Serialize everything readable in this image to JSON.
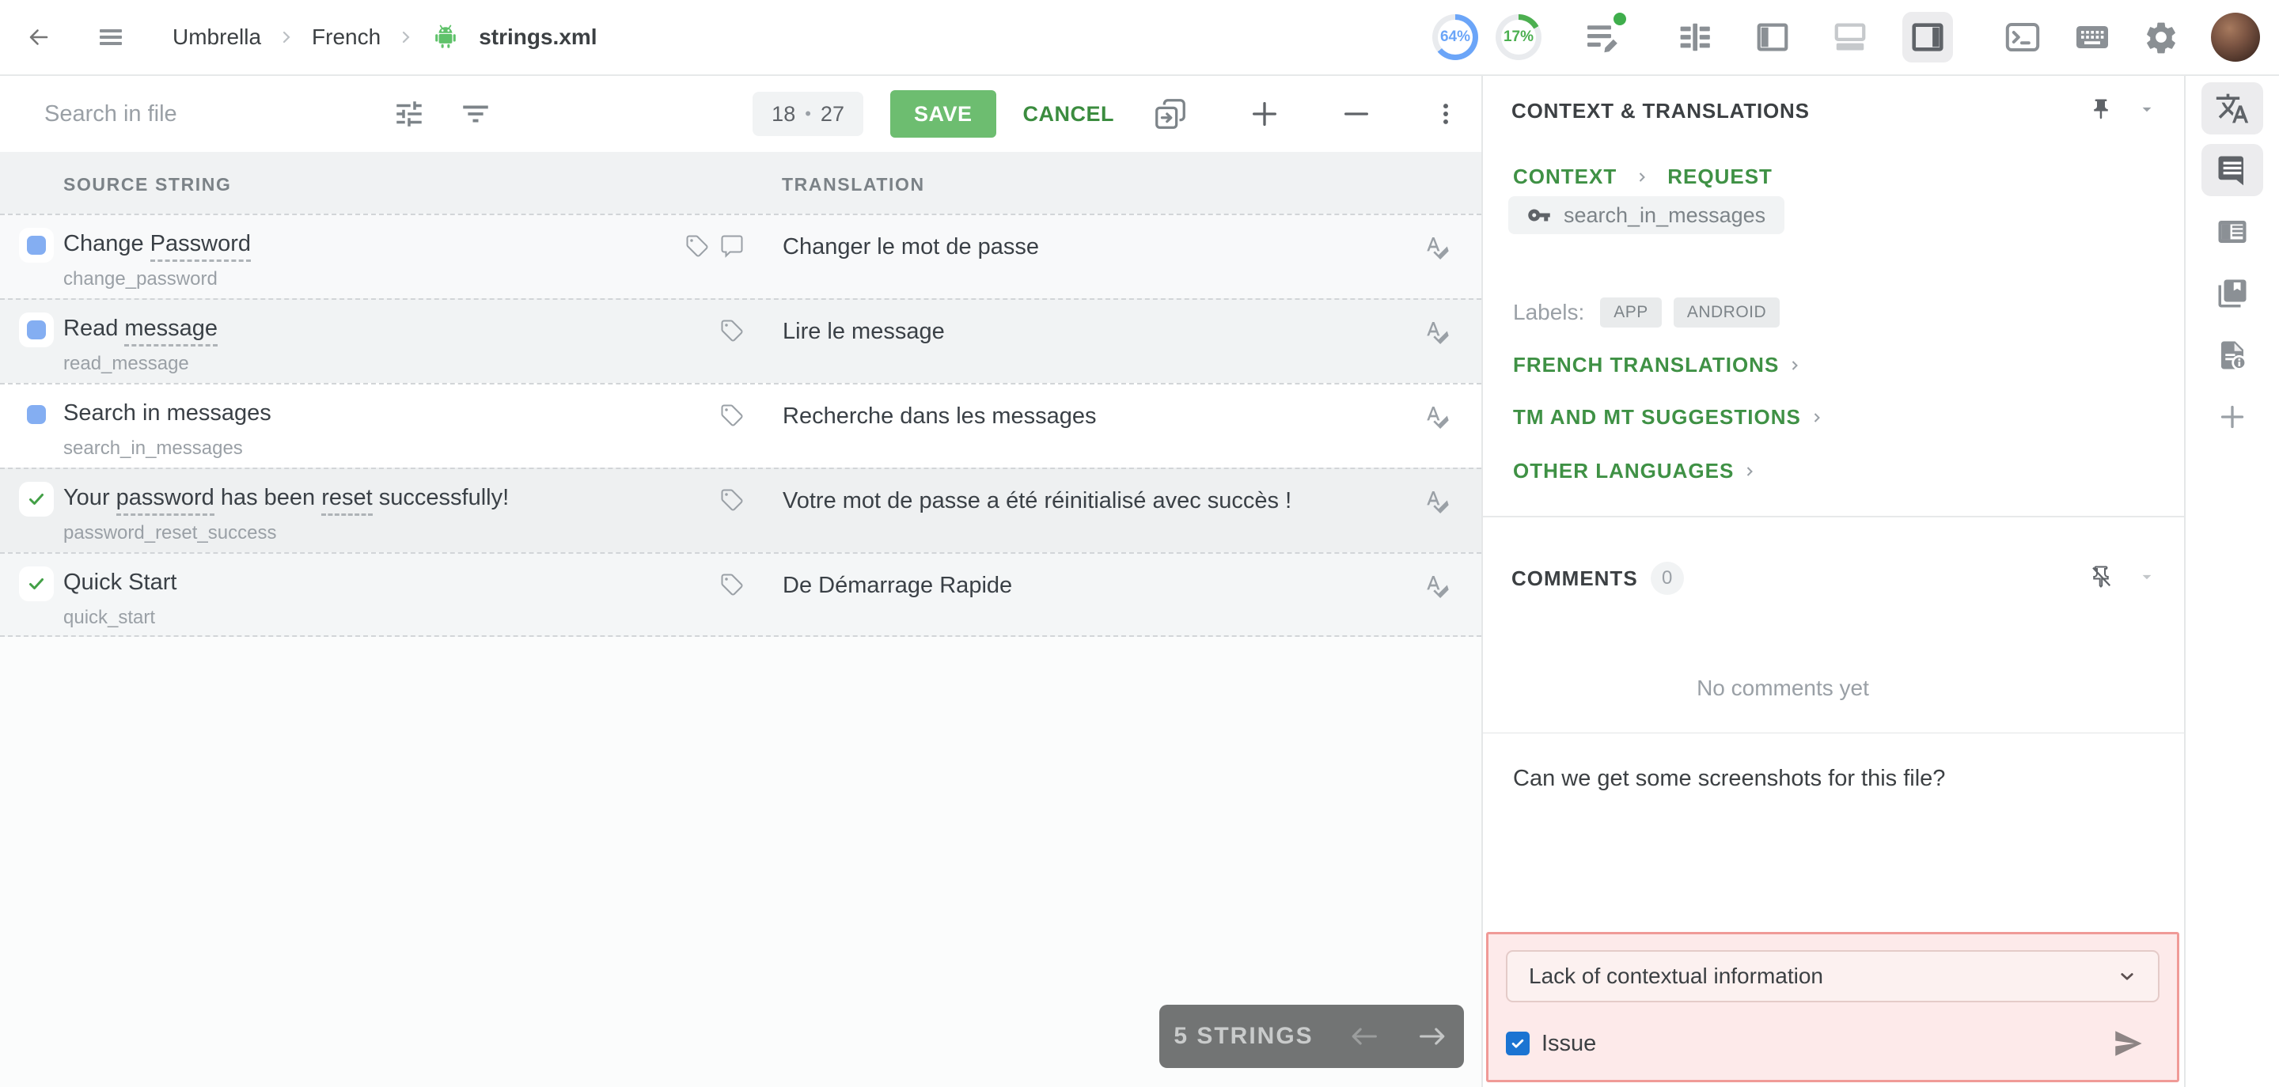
{
  "topbar": {
    "breadcrumb": {
      "project": "Umbrella",
      "language": "French",
      "file": "strings.xml"
    },
    "progress": [
      {
        "value": "64%",
        "pct": 64,
        "color": "#6ba5f8"
      },
      {
        "value": "17%",
        "pct": 17,
        "color": "#4caf50"
      }
    ]
  },
  "toolbar": {
    "search_placeholder": "Search in file",
    "counter": {
      "current": "18",
      "dot": "•",
      "total": "27"
    },
    "save_label": "SAVE",
    "save_color": "#6dbd70",
    "cancel_label": "CANCEL"
  },
  "grid": {
    "columns": [
      "SOURCE STRING",
      "TRANSLATION"
    ],
    "rows": [
      {
        "status": "active",
        "selected": false,
        "has_comment": true,
        "source": [
          {
            "t": "Change ",
            "u": false
          },
          {
            "t": "Password",
            "u": true
          }
        ],
        "key": "change_password",
        "translation": "Changer le mot de passe"
      },
      {
        "status": "active",
        "selected": false,
        "has_comment": false,
        "source": [
          {
            "t": "Read ",
            "u": false
          },
          {
            "t": "message",
            "u": true
          }
        ],
        "key": "read_message",
        "translation": "Lire le message"
      },
      {
        "status": "active",
        "selected": true,
        "has_comment": false,
        "source": [
          {
            "t": "Search in messages",
            "u": false
          }
        ],
        "key": "search_in_messages",
        "translation": "Recherche dans les messages"
      },
      {
        "status": "translated",
        "selected": false,
        "has_comment": false,
        "source": [
          {
            "t": "Your ",
            "u": false
          },
          {
            "t": "password",
            "u": true
          },
          {
            "t": " has been ",
            "u": false
          },
          {
            "t": "reset",
            "u": true
          },
          {
            "t": " successfully!",
            "u": false
          }
        ],
        "key": "password_reset_success",
        "translation": "Votre mot de passe a été réinitialisé avec succès !"
      },
      {
        "status": "translated",
        "selected": false,
        "has_comment": false,
        "source": [
          {
            "t": "Quick Start",
            "u": false
          }
        ],
        "key": "quick_start",
        "translation": "De Démarrage Rapide"
      }
    ],
    "footer": {
      "count_label": "5 STRINGS"
    },
    "status_colors": {
      "active": "#84aef2",
      "translated": "#43a047"
    }
  },
  "panel": {
    "title": "CONTEXT & TRANSLATIONS",
    "tabs": [
      "CONTEXT",
      "REQUEST"
    ],
    "string_key": "search_in_messages",
    "labels_caption": "Labels:",
    "labels": [
      "APP",
      "ANDROID"
    ],
    "links": [
      "FRENCH TRANSLATIONS",
      "TM AND MT SUGGESTIONS",
      "OTHER LANGUAGES"
    ],
    "accent_green": "#3f9145",
    "comments": {
      "title": "COMMENTS",
      "count": "0",
      "empty": "No comments yet",
      "draft": "Can we get some screenshots for this file?"
    },
    "issue": {
      "selected_option": "Lack of contextual information",
      "checkbox_label": "Issue",
      "checked": true,
      "border_color": "#f09a97",
      "bg_color": "#fdeaea",
      "checkbox_color": "#1b74d2"
    }
  }
}
